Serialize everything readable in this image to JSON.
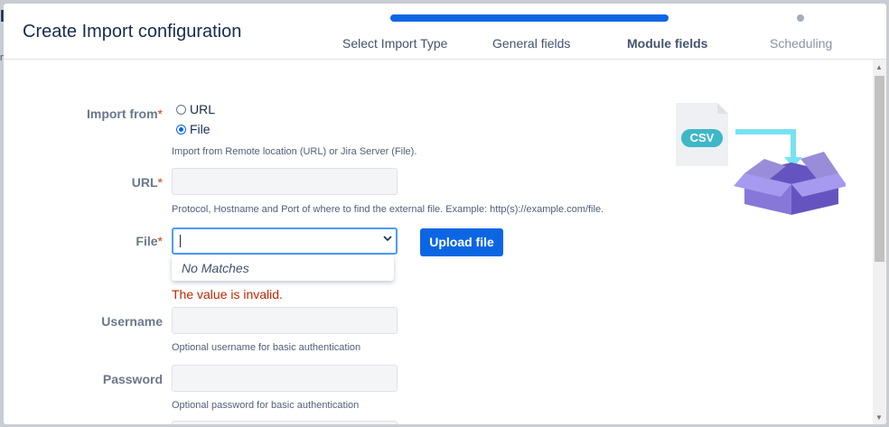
{
  "modal": {
    "title": "Create Import configuration"
  },
  "stepper": {
    "steps": [
      "Select Import Type",
      "General fields",
      "Module fields",
      "Scheduling"
    ],
    "current": "Module fields",
    "accent": "#0c66e4"
  },
  "form": {
    "import_from": {
      "label": "Import from",
      "options": [
        "URL",
        "File"
      ],
      "selected": "File",
      "help": "Import from Remote location (URL) or Jira Server (File)."
    },
    "url": {
      "label": "URL",
      "value": "",
      "help": "Protocol, Hostname and Port of where to find the external file. Example: http(s)://example.com/file."
    },
    "file": {
      "label": "File",
      "value": "",
      "dropdown_message": "No Matches",
      "error": "The value is invalid.",
      "upload_button": "Upload file"
    },
    "username": {
      "label": "Username",
      "value": "",
      "help": "Optional username for basic authentication"
    },
    "password": {
      "label": "Password",
      "value": "",
      "help": "Optional password for basic authentication"
    },
    "required_marker": "*"
  },
  "illustration": {
    "badge_text": "CSV",
    "icon": "csv-to-box-illustration"
  },
  "colors": {
    "primary": "#0c66e4",
    "error": "#bf2600",
    "required": "#de350b"
  }
}
